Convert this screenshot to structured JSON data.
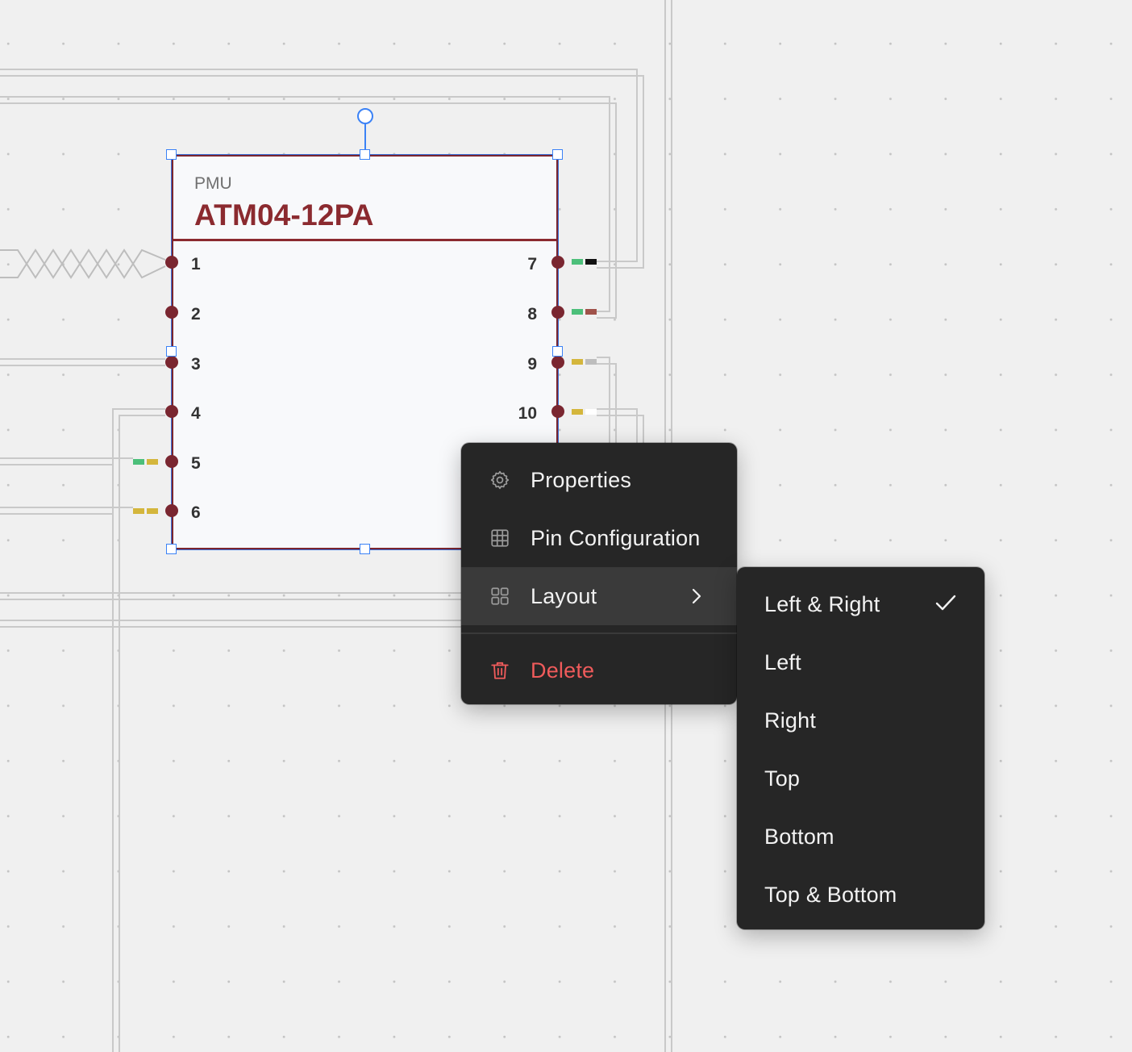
{
  "component": {
    "category": "PMU",
    "part_number": "ATM04-12PA",
    "pins_left": [
      "1",
      "2",
      "3",
      "4",
      "5",
      "6"
    ],
    "pins_right": [
      "7",
      "8",
      "9",
      "10"
    ],
    "accent_color": "#8b2a2f",
    "selection_color": "#3b82f6"
  },
  "context_menu": {
    "items": [
      {
        "label": "Properties",
        "icon": "gear-icon"
      },
      {
        "label": "Pin Configuration",
        "icon": "grid-icon"
      },
      {
        "label": "Layout",
        "icon": "layout-icon",
        "has_submenu": true,
        "active": true
      }
    ],
    "delete": {
      "label": "Delete",
      "icon": "trash-icon",
      "color": "#ef5b5b"
    }
  },
  "layout_submenu": {
    "items": [
      {
        "label": "Left & Right",
        "checked": true
      },
      {
        "label": "Left",
        "checked": false
      },
      {
        "label": "Right",
        "checked": false
      },
      {
        "label": "Top",
        "checked": false
      },
      {
        "label": "Bottom",
        "checked": false
      },
      {
        "label": "Top & Bottom",
        "checked": false
      }
    ]
  }
}
